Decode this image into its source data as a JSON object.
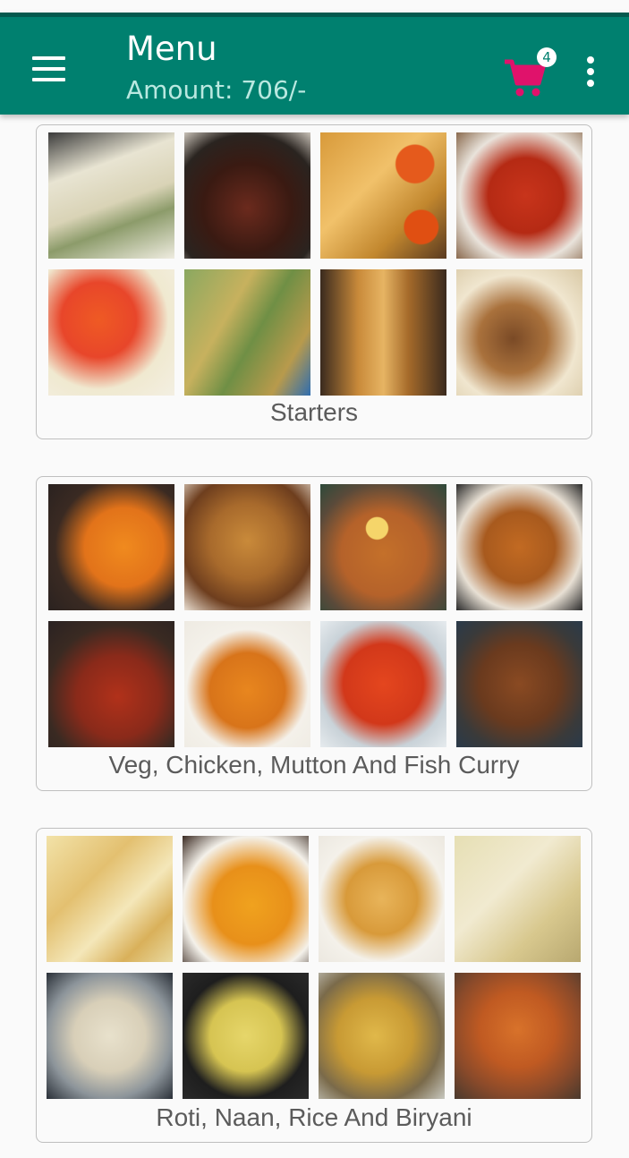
{
  "appbar": {
    "title": "Menu",
    "amount": "Amount: 706/-",
    "cart_count": "4",
    "colors": {
      "bar": "#00806f",
      "cart": "#e0126b"
    }
  },
  "icons": [
    "menu-icon",
    "cart-icon",
    "more-vert-icon"
  ],
  "categories": [
    {
      "label": "Starters",
      "tiles": [
        "malai-tikka",
        "lamb-chops",
        "spring-rolls",
        "chilli-fries",
        "tandoori-chicken",
        "seekh-kebab",
        "paneer-tikka",
        "roast-chicken"
      ]
    },
    {
      "label": "Veg, Chicken, Mutton And Fish Curry",
      "tiles": [
        "paneer-curry",
        "chicken-curry",
        "egg-kofta-curry",
        "matar-paneer",
        "mutton-curry",
        "butter-chicken",
        "paneer-makhani",
        "mutton-masala"
      ]
    },
    {
      "label": "Roti, Naan, Rice And Biryani",
      "tiles": [
        "butter-naan",
        "paratha",
        "lachha-paratha",
        "garlic-naan",
        "jeera-rice",
        "veg-pulao",
        "veg-biryani",
        "chicken-biryani"
      ]
    }
  ]
}
